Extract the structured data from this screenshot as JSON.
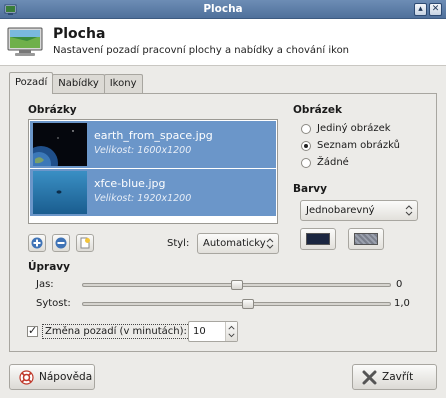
{
  "window": {
    "title": "Plocha",
    "controls": {
      "maximize_glyph": "▴",
      "close_glyph": "✕"
    }
  },
  "header": {
    "title": "Plocha",
    "subtitle": "Nastavení pozadí pracovní plochy a nabídky a chování ikon",
    "icon": "desktop-monitor-icon"
  },
  "tabs": [
    {
      "label": "Pozadí",
      "active": true
    },
    {
      "label": "Nabídky",
      "active": false
    },
    {
      "label": "Ikony",
      "active": false
    }
  ],
  "images": {
    "heading": "Obrázky",
    "items": [
      {
        "name": "earth_from_space.jpg",
        "size": "Velikost: 1600x1200",
        "thumb": "earth-thumbnail"
      },
      {
        "name": "xfce-blue.jpg",
        "size": "Velikost: 1920x1200",
        "thumb": "xfce-blue-thumbnail"
      }
    ],
    "buttons": {
      "add": "plus-icon",
      "remove": "minus-icon",
      "new_list": "document-icon"
    },
    "style_label": "Styl:",
    "style_value": "Automaticky"
  },
  "image_mode": {
    "heading": "Obrázek",
    "options": [
      {
        "label": "Jediný obrázek",
        "selected": false
      },
      {
        "label": "Seznam obrázků",
        "selected": true
      },
      {
        "label": "Žádné",
        "selected": false
      }
    ]
  },
  "colors": {
    "heading": "Barvy",
    "mode_value": "Jednobarevný",
    "primary": "#1b2640",
    "secondary": "#7a7f8c"
  },
  "adjustments": {
    "heading": "Úpravy",
    "brightness_label": "Jas:",
    "brightness_value": "0",
    "brightness_fraction": 0.5,
    "saturation_label": "Sytost:",
    "saturation_value": "1,0",
    "saturation_fraction": 0.54
  },
  "change_background": {
    "checked": true,
    "label": "Změna pozadí (v minutách):",
    "minutes": "10"
  },
  "footer": {
    "help_label": "Nápověda",
    "close_label": "Zavřít"
  }
}
